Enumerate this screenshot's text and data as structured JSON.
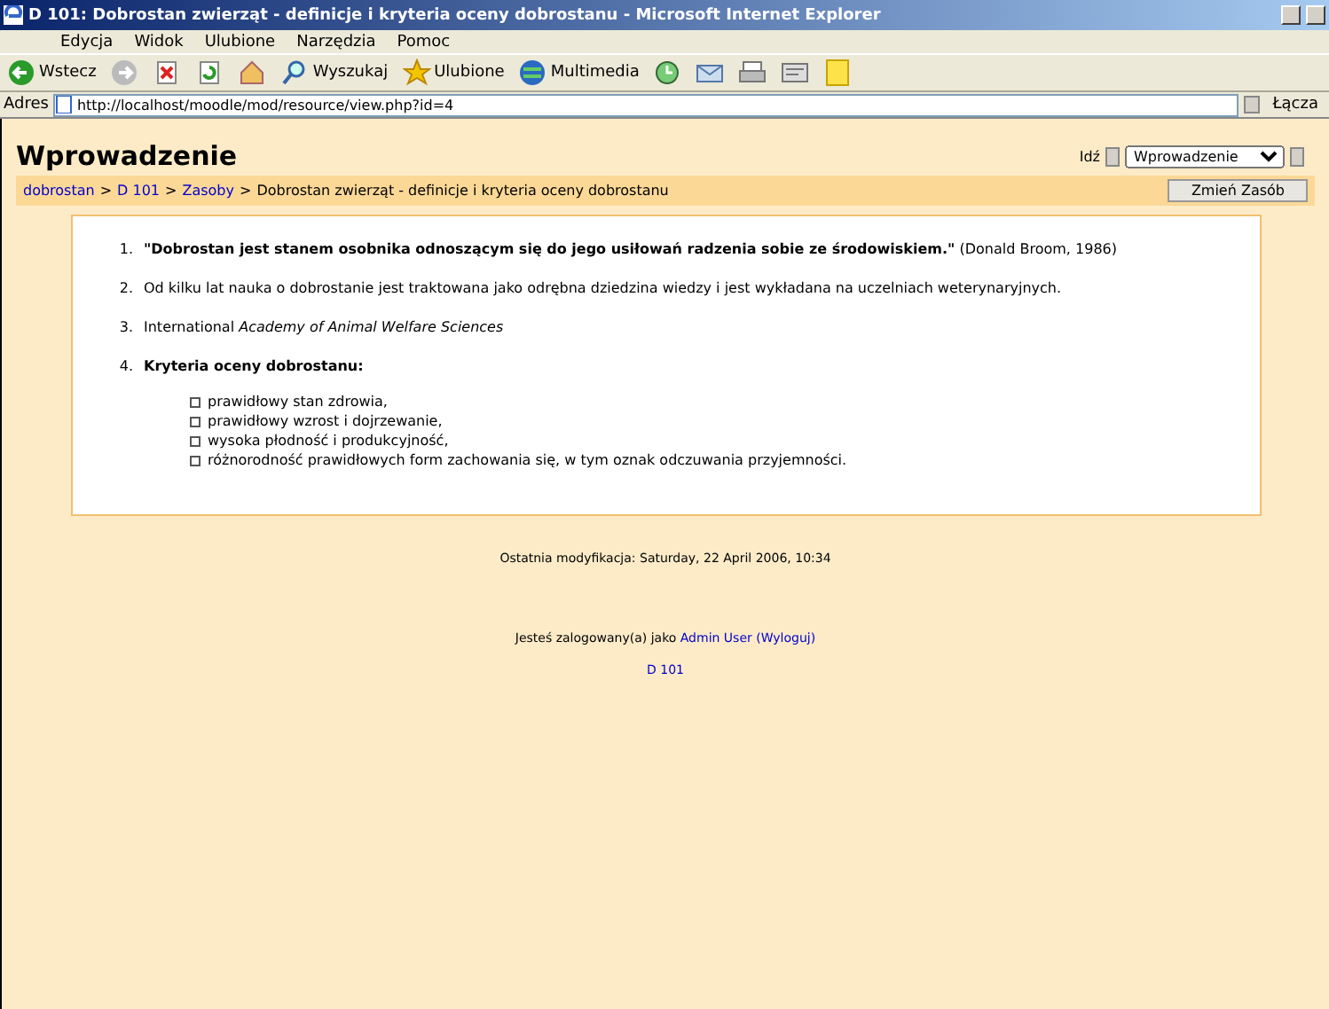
{
  "window": {
    "title": "D 101: Dobrostan zwierząt - definicje i kryteria oceny dobrostanu - Microsoft Internet Explorer"
  },
  "menu": [
    "Edycja",
    "Widok",
    "Ulubione",
    "Narzędzia",
    "Pomoc"
  ],
  "toolbar": [
    {
      "kind": "back",
      "label": "Wstecz"
    },
    {
      "kind": "forward"
    },
    {
      "kind": "stop"
    },
    {
      "kind": "refresh"
    },
    {
      "kind": "home"
    },
    {
      "kind": "search",
      "label": "Wyszukaj"
    },
    {
      "kind": "favorites",
      "label": "Ulubione"
    },
    {
      "kind": "media",
      "label": "Multimedia"
    },
    {
      "kind": "history"
    },
    {
      "kind": "mail"
    },
    {
      "kind": "print"
    },
    {
      "kind": "edit"
    },
    {
      "kind": "note"
    }
  ],
  "address": {
    "label": "Adres",
    "value": "http://localhost/moodle/mod/resource/view.php?id=4",
    "links": "Łącza"
  },
  "page": {
    "heading": "Wprowadzenie",
    "jump_label": "Idź",
    "jump_select": "Wprowadzenie",
    "breadcrumb_separator": ">",
    "breadcrumb": [
      {
        "text": "dobrostan",
        "link": true
      },
      {
        "text": "D 101",
        "link": true
      },
      {
        "text": "Zasoby",
        "link": true
      },
      {
        "text": "Dobrostan zwierząt - definicje i kryteria oceny dobrostanu",
        "link": false
      }
    ],
    "edit_button": "Zmień Zasób",
    "items": [
      {
        "number": "1.",
        "text": "**\"Dobrostan jest stanem osobnika odnoszącym się do jego usiłowań radzenia sobie ze środowiskiem.\"** (Donald Broom, 1986)"
      },
      {
        "number": "2.",
        "text": "Od kilku lat nauka o dobrostanie jest traktowana jako odrębna dziedzina wiedzy i jest wykładana na uczelniach weterynaryjnych."
      },
      {
        "number": "3.",
        "text": "International *Academy of Animal Welfare Sciences*"
      },
      {
        "number": "4.",
        "text": "**Kryteria oceny dobrostanu:**",
        "bullets": [
          "prawidłowy stan zdrowia,",
          "prawidłowy wzrost i dojrzewanie,",
          "wysoka płodność i produkcyjność,",
          "różnorodność prawidłowych form zachowania się, w tym oznak odczuwania przyjemności."
        ]
      }
    ],
    "modified": "Ostatnia modyfikacja: Saturday, 22 April 2006, 10:34",
    "login_text": "Jesteś zalogowany(a) jako",
    "login_user": "Admin User",
    "logout": "(Wyloguj)",
    "course_link": "D 101"
  }
}
